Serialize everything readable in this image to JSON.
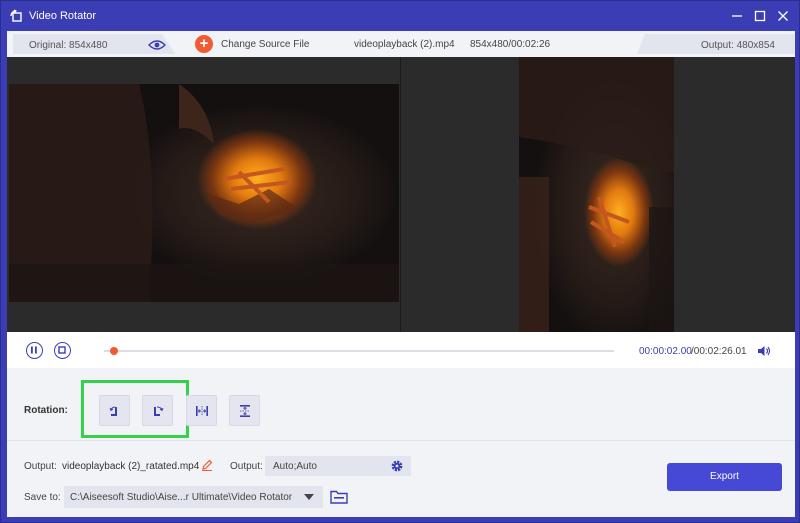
{
  "window": {
    "title": "Video Rotator",
    "icons": [
      "rotate-app-icon",
      "minimize-icon",
      "maximize-icon",
      "close-icon"
    ]
  },
  "infobar": {
    "original": "Original: 854x480",
    "change_source": "Change Source File",
    "filename": "videoplayback (2).mp4",
    "fileinfo": "854x480/00:02:26",
    "output": "Output: 480x854"
  },
  "playback": {
    "time_current": "00:00:02.00",
    "time_total": "/00:02:26.01",
    "progress_fraction": 0.014
  },
  "rotation": {
    "label": "Rotation:",
    "buttons": [
      "rotate-left",
      "rotate-right",
      "flip-horizontal",
      "flip-vertical"
    ]
  },
  "output": {
    "name_label": "Output:",
    "name_value": "videoplayback (2)_ratated.mp4",
    "format_label": "Output:",
    "format_value": "Auto;Auto"
  },
  "save": {
    "label": "Save to:",
    "path": "C:\\Aiseesoft Studio\\Aise...r Ultimate\\Video Rotator"
  },
  "export_label": "Export",
  "colors": {
    "accent": "#3b3db5",
    "button": "#4649d6",
    "highlight": "#36d14a",
    "orange": "#f15a34"
  }
}
